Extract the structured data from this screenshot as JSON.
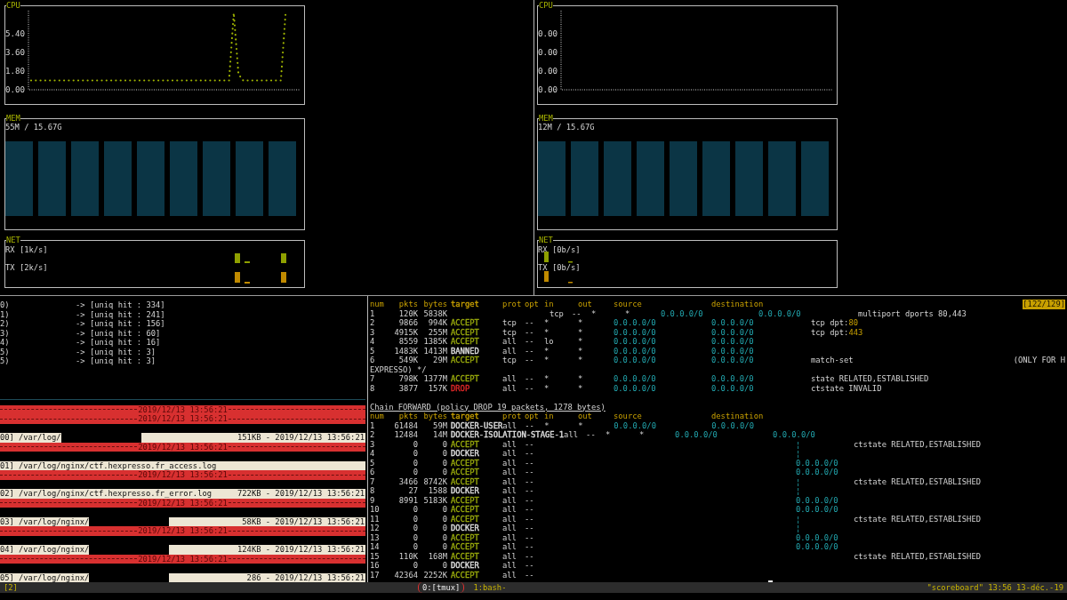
{
  "monitors": [
    {
      "cpu": {
        "title": "CPU",
        "chart_data": {
          "type": "line",
          "ylim": [
            0,
            7.6
          ],
          "yticks": [
            {
              "value": 0,
              "label": "0.00"
            },
            {
              "value": 1.8,
              "label": "1.80"
            },
            {
              "value": 3.6,
              "label": "3.60"
            },
            {
              "value": 5.4,
              "label": "5.40"
            }
          ],
          "series": [
            {
              "color": "#a0b400",
              "line_style": "dotted",
              "values": [
                0.9,
                0.9,
                0.9,
                0.9,
                0.9,
                0.9,
                0.9,
                0.9,
                0.9,
                0.9,
                0.9,
                0.9,
                0.9,
                0.9,
                0.9,
                0.9,
                0.9,
                0.9,
                0.9,
                0.9,
                0.9,
                0.9,
                0.9,
                0.9,
                0.9,
                0.9,
                0.9,
                0.9,
                0.9,
                0.9,
                0.9,
                0.9,
                0.9,
                0.9,
                0.9,
                0.9,
                0.9,
                0.9,
                0.9,
                0.9,
                0.9,
                0.9,
                0.9,
                7.4,
                1.5,
                0.9,
                0.9,
                0.9,
                0.9,
                0.9,
                0.9,
                0.9,
                0.9,
                0.9,
                7.4
              ]
            }
          ]
        }
      },
      "mem": {
        "title": "MEM",
        "usage": "55M / 15.67G"
      },
      "net": {
        "title": "NET",
        "rx": "RX [1k/s]",
        "tx": "TX [2k/s]"
      }
    },
    {
      "cpu": {
        "title": "CPU",
        "axis_labels": [
          "0.00",
          "0.00",
          "0.00",
          "0.00"
        ]
      },
      "mem": {
        "title": "MEM",
        "usage": "12M / 15.67G"
      },
      "net": {
        "title": "NET",
        "rx": "RX [0b/s]",
        "tx": "TX [0b/s]"
      }
    }
  ],
  "hits": [
    {
      "index": "0)",
      "text": "-> [uniq hit : 334]"
    },
    {
      "index": "1)",
      "text": "-> [uniq hit : 241]"
    },
    {
      "index": "2)",
      "text": "-> [uniq hit : 156]"
    },
    {
      "index": "3)",
      "text": "-> [uniq hit : 60]"
    },
    {
      "index": "4)",
      "text": "-> [uniq hit : 16]"
    },
    {
      "index": "5)",
      "text": "-> [uniq hit : 3]"
    },
    {
      "index": "5)",
      "text": "-> [uniq hit : 3]"
    }
  ],
  "logs": [
    {
      "kind": "separator",
      "date": "2019/12/13 13:56:21"
    },
    {
      "kind": "separator",
      "date": "2019/12/13 13:56:21"
    },
    {
      "kind": "file",
      "index": "00]",
      "path": "/var/log/",
      "redacted": true,
      "info": "151KB - 2019/12/13 13:56:21"
    },
    {
      "kind": "separator",
      "date": "2019/12/13 13:56:21"
    },
    {
      "kind": "file",
      "index": "01]",
      "path": "/var/log/nginx/ctf.hexpresso.fr_access.log",
      "redacted": false
    },
    {
      "kind": "separator",
      "date": "2019/12/13 13:56:21"
    },
    {
      "kind": "file",
      "index": "02]",
      "path": "/var/log/nginx/ctf.hexpresso.fr_error.log",
      "redacted": false,
      "info": "722KB - 2019/12/13 13:56:21"
    },
    {
      "kind": "separator",
      "date": "2019/12/13 13:56:21"
    },
    {
      "kind": "file",
      "index": "03]",
      "path": "/var/log/nginx/",
      "redacted": true,
      "info": "58KB - 2019/12/13 13:56:21"
    },
    {
      "kind": "separator",
      "date": "2019/12/13 13:56:21"
    },
    {
      "kind": "file",
      "index": "04]",
      "path": "/var/log/nginx/",
      "redacted": true,
      "info": "124KB - 2019/12/13 13:56:21"
    },
    {
      "kind": "separator",
      "date": "2019/12/13 13:56:21"
    },
    {
      "kind": "file",
      "index": "05]",
      "path": "/var/log/nginx/",
      "redacted": true,
      "info": "286 - 2019/12/13 13:56:21"
    }
  ],
  "position": "[122/129]",
  "input_chain": {
    "header": {
      "num": "num",
      "pkts": "pkts",
      "bytes": "bytes",
      "target": "target",
      "prot": "prot",
      "opt": "opt",
      "in": "in",
      "out": "out",
      "source": "source",
      "destination": "destination"
    },
    "rows": [
      {
        "kind": "rule",
        "shifted": true,
        "num": "1",
        "pkts": "120K",
        "bytes": "5838K",
        "prot": "tcp",
        "opt": "--",
        "in": "*",
        "out": "*",
        "source": "0.0.0.0/0",
        "destination": "0.0.0.0/0",
        "extra": "multiport dports 80,443"
      },
      {
        "kind": "rule",
        "shifted": false,
        "num": "2",
        "pkts": "9866",
        "bytes": "994K",
        "target": "ACCEPT",
        "color": "#9aab0c",
        "prot": "tcp",
        "opt": "--",
        "in": "*",
        "out": "*",
        "source": "0.0.0.0/0",
        "destination": "0.0.0.0/0",
        "extra": "tcp dpt:",
        "port": "80"
      },
      {
        "kind": "rule",
        "shifted": false,
        "num": "3",
        "pkts": "4915K",
        "bytes": "255M",
        "target": "ACCEPT",
        "color": "#9aab0c",
        "prot": "tcp",
        "opt": "--",
        "in": "*",
        "out": "*",
        "source": "0.0.0.0/0",
        "destination": "0.0.0.0/0",
        "extra": "tcp dpt:",
        "port": "443"
      },
      {
        "kind": "rule",
        "shifted": false,
        "num": "4",
        "pkts": "8559",
        "bytes": "1385K",
        "target": "ACCEPT",
        "color": "#9aab0c",
        "prot": "all",
        "opt": "--",
        "in": "lo",
        "out": "*",
        "source": "0.0.0.0/0",
        "destination": "0.0.0.0/0"
      },
      {
        "kind": "rule",
        "shifted": false,
        "num": "5",
        "pkts": "1483K",
        "bytes": "1413M",
        "target": "BANNED",
        "color": "#e0e0e0",
        "prot": "all",
        "opt": "--",
        "in": "*",
        "out": "*",
        "source": "0.0.0.0/0",
        "destination": "0.0.0.0/0"
      },
      {
        "kind": "rule",
        "shifted": false,
        "num": "6",
        "pkts": "549K",
        "bytes": "29M",
        "target": "ACCEPT",
        "color": "#9aab0c",
        "prot": "tcp",
        "opt": "--",
        "in": "*",
        "out": "*",
        "source": "0.0.0.0/0",
        "destination": "0.0.0.0/0",
        "extra": "match-set",
        "comment": "(ONLY FOR H"
      },
      {
        "kind": "wrap",
        "text": "EXPRESSO) */"
      },
      {
        "kind": "rule",
        "shifted": false,
        "num": "7",
        "pkts": "798K",
        "bytes": "1377M",
        "target": "ACCEPT",
        "color": "#9aab0c",
        "prot": "all",
        "opt": "--",
        "in": "*",
        "out": "*",
        "source": "0.0.0.0/0",
        "destination": "0.0.0.0/0",
        "extra": "state RELATED,ESTABLISHED"
      },
      {
        "kind": "rule",
        "shifted": false,
        "num": "8",
        "pkts": "3877",
        "bytes": "157K",
        "target": "DROP",
        "color": "#e02828",
        "prot": "all",
        "opt": "--",
        "in": "*",
        "out": "*",
        "source": "0.0.0.0/0",
        "destination": "0.0.0.0/0",
        "extra": "ctstate INVALID"
      }
    ]
  },
  "forward_chain": {
    "title": "Chain FORWARD (policy DROP 19 packets, 1278 bytes)",
    "header": {
      "num": "num",
      "pkts": "pkts",
      "bytes": "bytes",
      "target": "target",
      "prot": "prot",
      "opt": "opt",
      "in": "in",
      "out": "out",
      "source": "source",
      "destination": "destination"
    },
    "rows": [
      {
        "kind": "rule",
        "shifted": false,
        "num": "1",
        "pkts": "61484",
        "bytes": "59M",
        "target": "DOCKER-USER",
        "color": "#e0e0e0",
        "prot": "all",
        "opt": "--",
        "in": "*",
        "out": "*",
        "source": "0.0.0.0/0",
        "destination": "0.0.0.0/0"
      },
      {
        "kind": "rule",
        "shifted": false,
        "num": "2",
        "pkts": "12484",
        "bytes": "14M",
        "target": "DOCKER-ISOLATION-STAGE-1",
        "color": "#e0e0e0",
        "prot": "all",
        "opt": "--",
        "in": "*",
        "out": "*",
        "source": "0.0.0.0/0",
        "destination": "0.0.0.0/0"
      },
      {
        "kind": "stub",
        "num": "3",
        "pkts": "0",
        "bytes": "0",
        "target": "ACCEPT",
        "color": "#9aab0c",
        "prot": "all",
        "opt": "--",
        "trail": "¦",
        "extra": "ctstate RELATED,ESTABLISHED"
      },
      {
        "kind": "stub",
        "num": "4",
        "pkts": "0",
        "bytes": "0",
        "target": "DOCKER",
        "color": "#e0e0e0",
        "prot": "all",
        "opt": "--",
        "trail": "¦"
      },
      {
        "kind": "stub",
        "num": "5",
        "pkts": "0",
        "bytes": "0",
        "target": "ACCEPT",
        "color": "#9aab0c",
        "prot": "all",
        "opt": "--",
        "trail": "0.0.0.0/0"
      },
      {
        "kind": "stub",
        "num": "6",
        "pkts": "0",
        "bytes": "0",
        "target": "ACCEPT",
        "color": "#9aab0c",
        "prot": "all",
        "opt": "--",
        "trail": "0.0.0.0/0"
      },
      {
        "kind": "stub",
        "num": "7",
        "pkts": "3466",
        "bytes": "8742K",
        "target": "ACCEPT",
        "color": "#9aab0c",
        "prot": "all",
        "opt": "--",
        "trail": "¦",
        "extra": "ctstate RELATED,ESTABLISHED"
      },
      {
        "kind": "stub",
        "num": "8",
        "pkts": "27",
        "bytes": "1588",
        "target": "DOCKER",
        "color": "#e0e0e0",
        "prot": "all",
        "opt": "--",
        "trail": "¦"
      },
      {
        "kind": "stub",
        "num": "9",
        "pkts": "8991",
        "bytes": "5183K",
        "target": "ACCEPT",
        "color": "#9aab0c",
        "prot": "all",
        "opt": "--",
        "trail": "0.0.0.0/0"
      },
      {
        "kind": "stub",
        "num": "10",
        "pkts": "0",
        "bytes": "0",
        "target": "ACCEPT",
        "color": "#9aab0c",
        "prot": "all",
        "opt": "--",
        "trail": "0.0.0.0/0"
      },
      {
        "kind": "stub",
        "num": "11",
        "pkts": "0",
        "bytes": "0",
        "target": "ACCEPT",
        "color": "#9aab0c",
        "prot": "all",
        "opt": "--",
        "trail": "¦",
        "extra": "ctstate RELATED,ESTABLISHED"
      },
      {
        "kind": "stub",
        "num": "12",
        "pkts": "0",
        "bytes": "0",
        "target": "DOCKER",
        "color": "#e0e0e0",
        "prot": "all",
        "opt": "--",
        "trail": "¦"
      },
      {
        "kind": "stub",
        "num": "13",
        "pkts": "0",
        "bytes": "0",
        "target": "ACCEPT",
        "color": "#9aab0c",
        "prot": "all",
        "opt": "--",
        "trail": "0.0.0.0/0"
      },
      {
        "kind": "stub",
        "num": "14",
        "pkts": "0",
        "bytes": "0",
        "target": "ACCEPT",
        "color": "#9aab0c",
        "prot": "all",
        "opt": "--",
        "trail": "0.0.0.0/0"
      },
      {
        "kind": "stub",
        "num": "15",
        "pkts": "110K",
        "bytes": "168M",
        "target": "ACCEPT",
        "color": "#9aab0c",
        "prot": "all",
        "opt": "--",
        "extra": "ctstate RELATED,ESTABLISHED"
      },
      {
        "kind": "stub",
        "num": "16",
        "pkts": "0",
        "bytes": "0",
        "target": "DOCKER",
        "color": "#e0e0e0",
        "prot": "all",
        "opt": "--"
      },
      {
        "kind": "stub",
        "num": "17",
        "pkts": "42364",
        "bytes": "2252K",
        "target": "ACCEPT",
        "color": "#9aab0c",
        "prot": "all",
        "opt": "--"
      }
    ]
  },
  "status_bar": {
    "session": "[2]",
    "windows": [
      {
        "label": "0:[tmux]",
        "selected": true
      },
      {
        "label": "1:bash-",
        "selected": false
      }
    ],
    "right": "\"scoreboard\" 13:56 13-déc.-19"
  }
}
